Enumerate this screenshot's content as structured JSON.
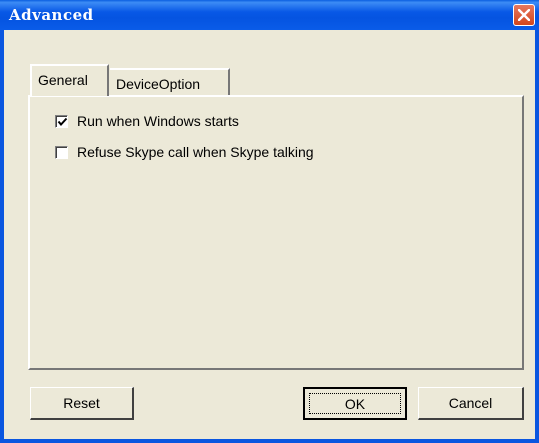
{
  "window": {
    "title": "Advanced",
    "close_icon": "close-icon"
  },
  "tabs": [
    {
      "label": "General",
      "selected": true
    },
    {
      "label": "DeviceOption",
      "selected": false
    }
  ],
  "general": {
    "options": [
      {
        "label": "Run when Windows starts",
        "checked": true
      },
      {
        "label": "Refuse Skype call when Skype talking",
        "checked": false
      }
    ]
  },
  "buttons": {
    "reset": "Reset",
    "ok": "OK",
    "cancel": "Cancel"
  },
  "colors": {
    "titlebar": "#0554e1",
    "close": "#d2461c",
    "face": "#ece9d8"
  }
}
